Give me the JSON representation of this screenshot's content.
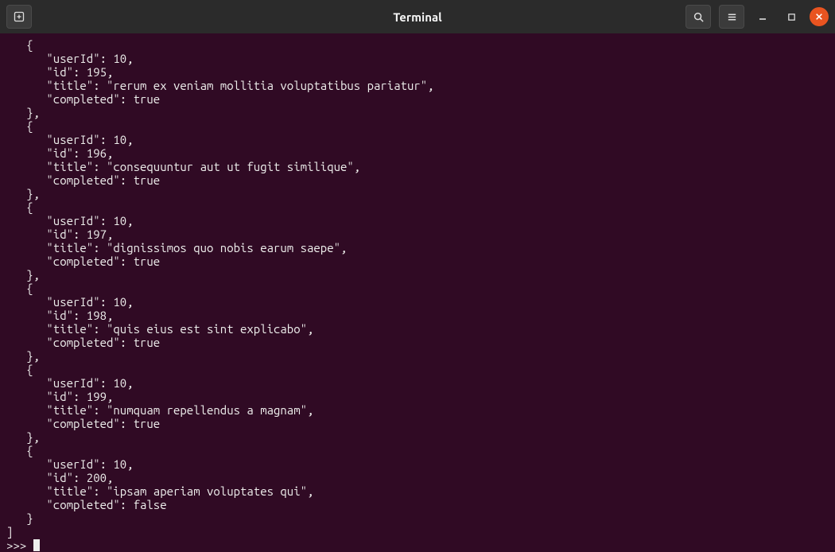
{
  "window": {
    "title": "Terminal"
  },
  "prompt": ">>> ",
  "array_end": "]",
  "records": [
    {
      "userId": 10,
      "id": 195,
      "title": "rerum ex veniam mollitia voluptatibus pariatur",
      "completed": true
    },
    {
      "userId": 10,
      "id": 196,
      "title": "consequuntur aut ut fugit similique",
      "completed": true
    },
    {
      "userId": 10,
      "id": 197,
      "title": "dignissimos quo nobis earum saepe",
      "completed": true
    },
    {
      "userId": 10,
      "id": 198,
      "title": "quis eius est sint explicabo",
      "completed": true
    },
    {
      "userId": 10,
      "id": 199,
      "title": "numquam repellendus a magnam",
      "completed": true
    },
    {
      "userId": 10,
      "id": 200,
      "title": "ipsam aperiam voluptates qui",
      "completed": false
    }
  ]
}
